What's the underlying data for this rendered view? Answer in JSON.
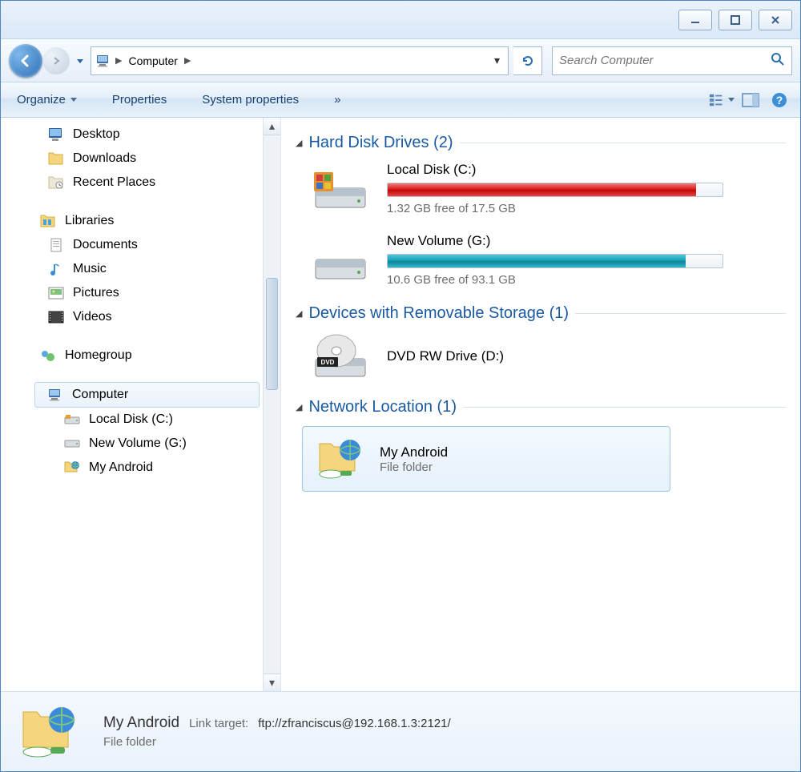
{
  "breadcrumb": {
    "root": "Computer"
  },
  "search": {
    "placeholder": "Search Computer"
  },
  "toolbar": {
    "organize": "Organize",
    "properties": "Properties",
    "system_properties": "System properties",
    "overflow": "»"
  },
  "sidebar": {
    "favorites": [
      {
        "label": "Desktop"
      },
      {
        "label": "Downloads"
      },
      {
        "label": "Recent Places"
      }
    ],
    "libraries_label": "Libraries",
    "libraries": [
      {
        "label": "Documents"
      },
      {
        "label": "Music"
      },
      {
        "label": "Pictures"
      },
      {
        "label": "Videos"
      }
    ],
    "homegroup": "Homegroup",
    "computer": "Computer",
    "drives": [
      {
        "label": "Local Disk (C:)"
      },
      {
        "label": "New Volume (G:)"
      },
      {
        "label": "My Android"
      }
    ]
  },
  "sections": {
    "hdd": {
      "title": "Hard Disk Drives (2)"
    },
    "removable": {
      "title": "Devices with Removable Storage (1)"
    },
    "network": {
      "title": "Network Location (1)"
    }
  },
  "drives": {
    "c": {
      "name": "Local Disk (C:)",
      "free": "1.32 GB free of 17.5 GB",
      "fill_pct": 92
    },
    "g": {
      "name": "New Volume (G:)",
      "free": "10.6 GB free of 93.1 GB",
      "fill_pct": 89
    }
  },
  "dvd": {
    "name": "DVD RW Drive (D:)"
  },
  "netloc": {
    "name": "My Android",
    "type": "File folder"
  },
  "details": {
    "title": "My Android",
    "link_target_label": "Link target:",
    "link_target": "ftp://zfranciscus@192.168.1.3:2121/",
    "type": "File folder"
  }
}
